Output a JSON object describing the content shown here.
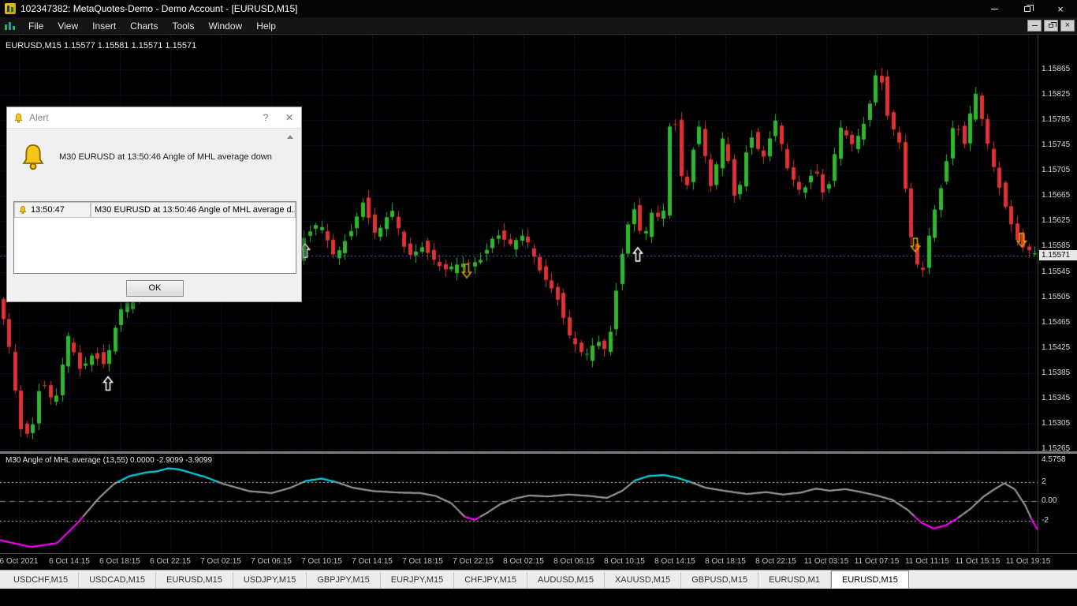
{
  "window": {
    "title": "102347382: MetaQuotes-Demo - Demo Account - [EURUSD,M15]"
  },
  "menubar": {
    "items": [
      "File",
      "View",
      "Insert",
      "Charts",
      "Tools",
      "Window",
      "Help"
    ]
  },
  "chart": {
    "symbol_label": "EURUSD,M15  1.15577 1.15581 1.15571 1.15571",
    "bid_price": "1.15571",
    "price_scale": [
      "1.15865",
      "1.15825",
      "1.15785",
      "1.15745",
      "1.15705",
      "1.15665",
      "1.15625",
      "1.15585",
      "1.15545",
      "1.15505",
      "1.15465",
      "1.15425",
      "1.15385",
      "1.15345",
      "1.15305",
      "1.15265"
    ],
    "colors": {
      "up": "#2eb82e",
      "down": "#e03232",
      "grid": "#20205e",
      "bid_line": "#4a63d8",
      "arrow_up": "#ffffff",
      "arrow_down": "#d9a300"
    }
  },
  "indicator": {
    "label": "M30 Angle of MHL average (13,55) 0.0000 -2.9099 -3.9099",
    "scale": {
      "top": "4.5758",
      "upper": "2",
      "zero": "0.00",
      "lower": "-2",
      "bottom": "-6.3081"
    },
    "colors": {
      "gray": "#9a9a9a",
      "cyan": "#00d9e8",
      "magenta": "#ff00ff",
      "level": "#c8c8c8",
      "zero_line": "#8c8c8c"
    }
  },
  "alert_dialog": {
    "title": "Alert",
    "help_glyph": "?",
    "close_glyph": "✕",
    "message": "M30 EURUSD at 13:50:46 Angle of MHL average down",
    "row": {
      "time": "13:50:47",
      "text": "M30 EURUSD at 13:50:46 Angle of MHL average d..."
    },
    "ok_label": "OK"
  },
  "time_axis": {
    "labels": [
      "6 Oct 2021",
      "6 Oct 14:15",
      "6 Oct 18:15",
      "6 Oct 22:15",
      "7 Oct 02:15",
      "7 Oct 06:15",
      "7 Oct 10:15",
      "7 Oct 14:15",
      "7 Oct 18:15",
      "7 Oct 22:15",
      "8 Oct 02:15",
      "8 Oct 06:15",
      "8 Oct 10:15",
      "8 Oct 14:15",
      "8 Oct 18:15",
      "8 Oct 22:15",
      "11 Oct 03:15",
      "11 Oct 07:15",
      "11 Oct 11:15",
      "11 Oct 15:15",
      "11 Oct 19:15"
    ]
  },
  "tabs": {
    "items": [
      "USDCHF,M15",
      "USDCAD,M15",
      "EURUSD,M15",
      "USDJPY,M15",
      "GBPJPY,M15",
      "EURJPY,M15",
      "CHFJPY,M15",
      "AUDUSD,M15",
      "XAUUSD,M15",
      "GBPUSD,M15",
      "EURUSD,M1",
      "EURUSD,M15"
    ],
    "active_index": 11
  },
  "chart_data": {
    "type": "candlestick",
    "title": "EURUSD,M15",
    "price_axis": {
      "min": 1.15265,
      "max": 1.15865,
      "step": 0.0004,
      "bid": 1.15571
    },
    "price_pivots": [
      [
        0.0,
        1.155
      ],
      [
        0.01,
        1.1544
      ],
      [
        0.022,
        1.153
      ],
      [
        0.032,
        1.1529
      ],
      [
        0.042,
        1.1538
      ],
      [
        0.055,
        1.1533
      ],
      [
        0.068,
        1.1544
      ],
      [
        0.08,
        1.1539
      ],
      [
        0.092,
        1.1542
      ],
      [
        0.104,
        1.154
      ],
      [
        0.118,
        1.1548
      ],
      [
        0.13,
        1.155
      ],
      [
        0.155,
        1.1556
      ],
      [
        0.185,
        1.1553
      ],
      [
        0.21,
        1.1558
      ],
      [
        0.235,
        1.15555
      ],
      [
        0.258,
        1.15515
      ],
      [
        0.272,
        1.15545
      ],
      [
        0.285,
        1.1554
      ],
      [
        0.295,
        1.156
      ],
      [
        0.31,
        1.1562
      ],
      [
        0.325,
        1.15565
      ],
      [
        0.34,
        1.1561
      ],
      [
        0.352,
        1.1566
      ],
      [
        0.365,
        1.156
      ],
      [
        0.38,
        1.1564
      ],
      [
        0.395,
        1.1557
      ],
      [
        0.41,
        1.1559
      ],
      [
        0.43,
        1.15545
      ],
      [
        0.45,
        1.15555
      ],
      [
        0.465,
        1.15565
      ],
      [
        0.48,
        1.1561
      ],
      [
        0.495,
        1.15585
      ],
      [
        0.508,
        1.156
      ],
      [
        0.522,
        1.1555
      ],
      [
        0.538,
        1.15515
      ],
      [
        0.552,
        1.1544
      ],
      [
        0.566,
        1.15405
      ],
      [
        0.578,
        1.15435
      ],
      [
        0.588,
        1.1542
      ],
      [
        0.6,
        1.1556
      ],
      [
        0.612,
        1.15655
      ],
      [
        0.622,
        1.1559
      ],
      [
        0.632,
        1.1564
      ],
      [
        0.641,
        1.15615
      ],
      [
        0.65,
        1.1583
      ],
      [
        0.662,
        1.1566
      ],
      [
        0.675,
        1.15785
      ],
      [
        0.688,
        1.15672
      ],
      [
        0.7,
        1.1576
      ],
      [
        0.712,
        1.1565
      ],
      [
        0.725,
        1.1577
      ],
      [
        0.738,
        1.15725
      ],
      [
        0.75,
        1.1578
      ],
      [
        0.762,
        1.157
      ],
      [
        0.775,
        1.1567
      ],
      [
        0.788,
        1.15715
      ],
      [
        0.798,
        1.1566
      ],
      [
        0.812,
        1.1577
      ],
      [
        0.825,
        1.1574
      ],
      [
        0.838,
        1.1579
      ],
      [
        0.849,
        1.1588
      ],
      [
        0.858,
        1.15795
      ],
      [
        0.87,
        1.15745
      ],
      [
        0.88,
        1.156
      ],
      [
        0.89,
        1.15525
      ],
      [
        0.9,
        1.15625
      ],
      [
        0.912,
        1.157
      ],
      [
        0.922,
        1.1579
      ],
      [
        0.932,
        1.15745
      ],
      [
        0.942,
        1.1583
      ],
      [
        0.952,
        1.1576
      ],
      [
        0.962,
        1.157
      ],
      [
        0.974,
        1.1564
      ],
      [
        0.985,
        1.1559
      ],
      [
        1.0,
        1.15571
      ]
    ],
    "arrows": [
      {
        "t": 0.104,
        "price": 1.15368,
        "dir": "up"
      },
      {
        "t": 0.294,
        "price": 1.15578,
        "dir": "up"
      },
      {
        "t": 0.615,
        "price": 1.15572,
        "dir": "up"
      },
      {
        "t": 0.45,
        "price": 1.15547,
        "dir": "down"
      },
      {
        "t": 0.882,
        "price": 1.15588,
        "dir": "down"
      },
      {
        "t": 0.985,
        "price": 1.15596,
        "dir": "down"
      }
    ],
    "indicator_axis": {
      "min": -6.3081,
      "max": 4.5758,
      "levels": [
        2,
        0,
        -2
      ],
      "cyan_above": 2,
      "magenta_below": -1.6
    },
    "indicator_pivots": [
      [
        0.0,
        -4.0
      ],
      [
        0.03,
        -4.7
      ],
      [
        0.055,
        -4.3
      ],
      [
        0.075,
        -2.2
      ],
      [
        0.095,
        0.3
      ],
      [
        0.11,
        1.8
      ],
      [
        0.125,
        2.6
      ],
      [
        0.14,
        2.95
      ],
      [
        0.152,
        3.1
      ],
      [
        0.162,
        3.4
      ],
      [
        0.172,
        3.3
      ],
      [
        0.185,
        2.9
      ],
      [
        0.198,
        2.5
      ],
      [
        0.215,
        1.8
      ],
      [
        0.24,
        1.05
      ],
      [
        0.262,
        0.85
      ],
      [
        0.28,
        1.4
      ],
      [
        0.295,
        2.1
      ],
      [
        0.31,
        2.35
      ],
      [
        0.325,
        1.95
      ],
      [
        0.34,
        1.4
      ],
      [
        0.36,
        1.05
      ],
      [
        0.385,
        0.9
      ],
      [
        0.405,
        0.85
      ],
      [
        0.42,
        0.55
      ],
      [
        0.435,
        -0.2
      ],
      [
        0.448,
        -1.6
      ],
      [
        0.458,
        -1.9
      ],
      [
        0.47,
        -1.15
      ],
      [
        0.482,
        -0.3
      ],
      [
        0.495,
        0.25
      ],
      [
        0.51,
        0.6
      ],
      [
        0.528,
        0.5
      ],
      [
        0.548,
        0.7
      ],
      [
        0.568,
        0.55
      ],
      [
        0.585,
        0.35
      ],
      [
        0.6,
        1.1
      ],
      [
        0.612,
        2.15
      ],
      [
        0.625,
        2.6
      ],
      [
        0.64,
        2.7
      ],
      [
        0.652,
        2.45
      ],
      [
        0.665,
        2.0
      ],
      [
        0.68,
        1.4
      ],
      [
        0.7,
        1.05
      ],
      [
        0.72,
        0.75
      ],
      [
        0.738,
        0.95
      ],
      [
        0.755,
        0.7
      ],
      [
        0.772,
        0.9
      ],
      [
        0.786,
        1.3
      ],
      [
        0.8,
        1.1
      ],
      [
        0.815,
        1.25
      ],
      [
        0.83,
        0.95
      ],
      [
        0.845,
        0.6
      ],
      [
        0.86,
        0.15
      ],
      [
        0.875,
        -0.9
      ],
      [
        0.888,
        -2.2
      ],
      [
        0.9,
        -2.8
      ],
      [
        0.912,
        -2.45
      ],
      [
        0.922,
        -1.8
      ],
      [
        0.935,
        -0.8
      ],
      [
        0.948,
        0.5
      ],
      [
        0.96,
        1.35
      ],
      [
        0.968,
        1.85
      ],
      [
        0.978,
        1.25
      ],
      [
        0.988,
        -0.4
      ],
      [
        0.995,
        -2.0
      ],
      [
        1.0,
        -2.9
      ]
    ]
  }
}
